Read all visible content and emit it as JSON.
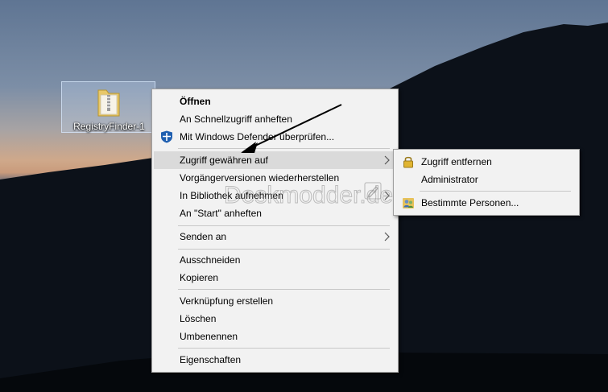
{
  "desktop": {
    "icon_label": "RegistryFinder-1"
  },
  "context_menu": {
    "items": [
      {
        "label": "Öffnen"
      },
      {
        "label": "An Schnellzugriff anheften"
      },
      {
        "label": "Mit Windows Defender überprüfen..."
      },
      {
        "label": "Zugriff gewähren auf"
      },
      {
        "label": "Vorgängerversionen wiederherstellen"
      },
      {
        "label": "In Bibliothek aufnehmen"
      },
      {
        "label": "An \"Start\" anheften"
      },
      {
        "label": "Senden an"
      },
      {
        "label": "Ausschneiden"
      },
      {
        "label": "Kopieren"
      },
      {
        "label": "Verknüpfung erstellen"
      },
      {
        "label": "Löschen"
      },
      {
        "label": "Umbenennen"
      },
      {
        "label": "Eigenschaften"
      }
    ]
  },
  "submenu": {
    "items": [
      {
        "label": "Zugriff entfernen"
      },
      {
        "label": "Administrator"
      },
      {
        "label": "Bestimmte Personen..."
      }
    ]
  },
  "watermark": "Deskmodder.de",
  "colors": {
    "menu_bg": "#f2f2f2",
    "highlight": "#dadada",
    "separator": "#c8c8c8"
  }
}
